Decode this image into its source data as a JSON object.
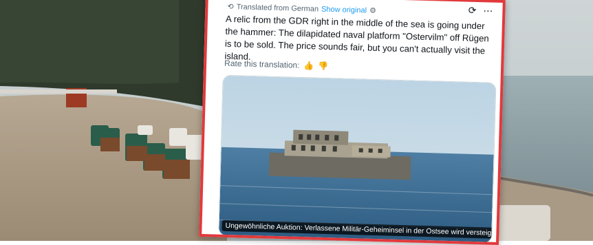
{
  "post": {
    "translated_from": "Translated from German",
    "show_original": "Show original",
    "text": "A relic from the GDR right in the middle of the sea is going under the hammer: The dilapidated naval platform \"Ostervilm\" off Rügen is to be sold. The price sounds fair, but you can't actually visit the island.",
    "rate_label": "Rate this translation:",
    "image_caption": "Ungewöhnliche Auktion: Verlassene Militär-Geheiminsel in der Ostsee wird versteigert"
  },
  "icons": {
    "translate": "translate-icon",
    "thumbs_up": "thumbs-up-icon",
    "thumbs_down": "thumbs-down-icon",
    "grok": "grok-icon",
    "more": "more-icon"
  },
  "colors": {
    "border": "#e2393c",
    "link": "#1d9bf0",
    "text": "#0f1419",
    "muted": "#536471"
  }
}
